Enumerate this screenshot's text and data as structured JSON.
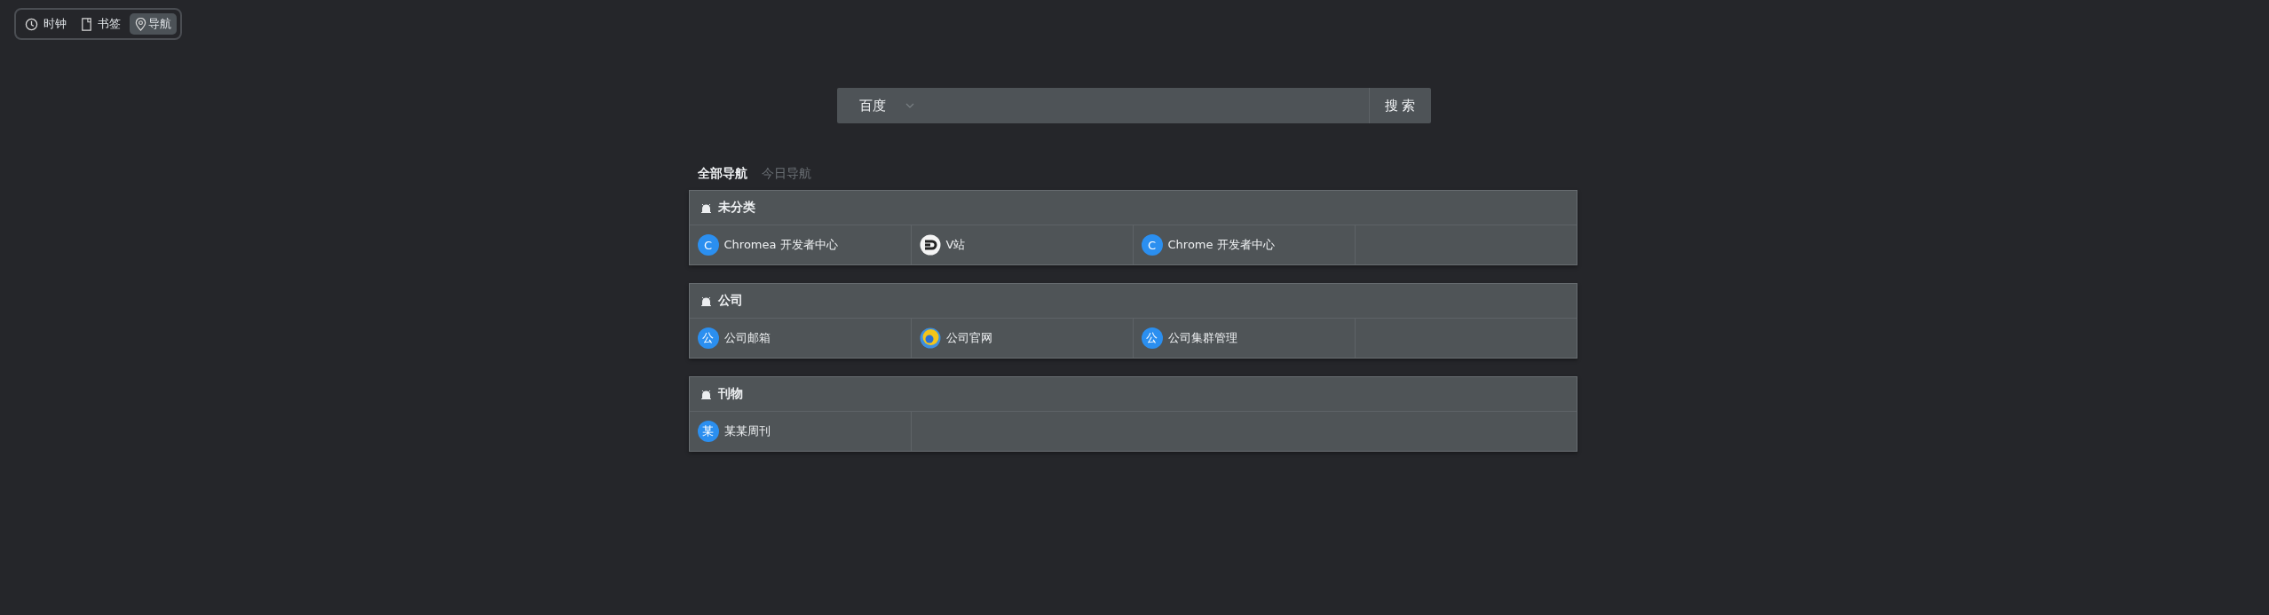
{
  "mode_tabs": [
    {
      "label": "时钟",
      "kind": "clock",
      "selected": false
    },
    {
      "label": "书签",
      "kind": "page",
      "selected": false
    },
    {
      "label": "导航",
      "kind": "pin",
      "selected": true
    }
  ],
  "search": {
    "engine": "百度",
    "button": "搜 索"
  },
  "nav_tabs": [
    {
      "label": "全部导航",
      "selected": true
    },
    {
      "label": "今日导航",
      "selected": false
    }
  ],
  "groups": [
    {
      "title": "未分类",
      "links": [
        {
          "label": "Chromea 开发者中心",
          "kind": "letter",
          "badge": "C"
        },
        {
          "label": "V站",
          "kind": "arrow-logo"
        },
        {
          "label": "Chrome 开发者中心",
          "kind": "letter",
          "badge": "C"
        }
      ]
    },
    {
      "title": "公司",
      "links": [
        {
          "label": "公司邮箱",
          "kind": "letter",
          "badge": "公"
        },
        {
          "label": "公司官网",
          "kind": "ring-logo"
        },
        {
          "label": "公司集群管理",
          "kind": "letter",
          "badge": "公"
        }
      ]
    },
    {
      "title": "刊物",
      "links": [
        {
          "label": "某某周刊",
          "kind": "letter",
          "badge": "某"
        }
      ]
    }
  ]
}
